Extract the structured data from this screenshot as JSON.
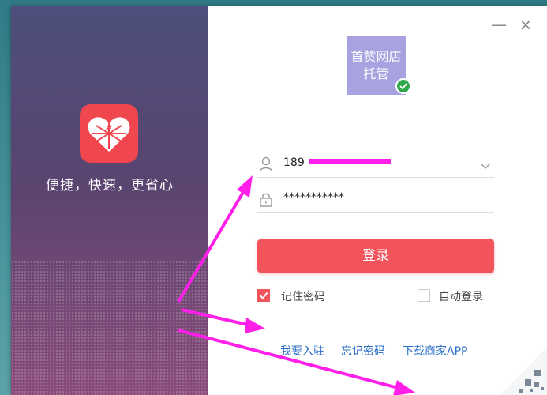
{
  "window": {
    "minimize_label": "—",
    "close_label": "×"
  },
  "brand": {
    "tagline": "便捷，快速，更省心"
  },
  "account": {
    "avatar_text_line1": "首赞网店",
    "avatar_text_line2": "托管"
  },
  "login_form": {
    "username_visible_prefix": "189",
    "password_masked": "***********",
    "login_button": "登录",
    "remember_password": "记住密码",
    "auto_login": "自动登录",
    "remember_checked": true,
    "auto_checked": false
  },
  "links": {
    "join": "我要入驻",
    "forgot": "忘记密码",
    "download": "下载商家APP"
  },
  "colors": {
    "brand_red": "#f2545b",
    "annotation_magenta": "#ff1fe8"
  }
}
